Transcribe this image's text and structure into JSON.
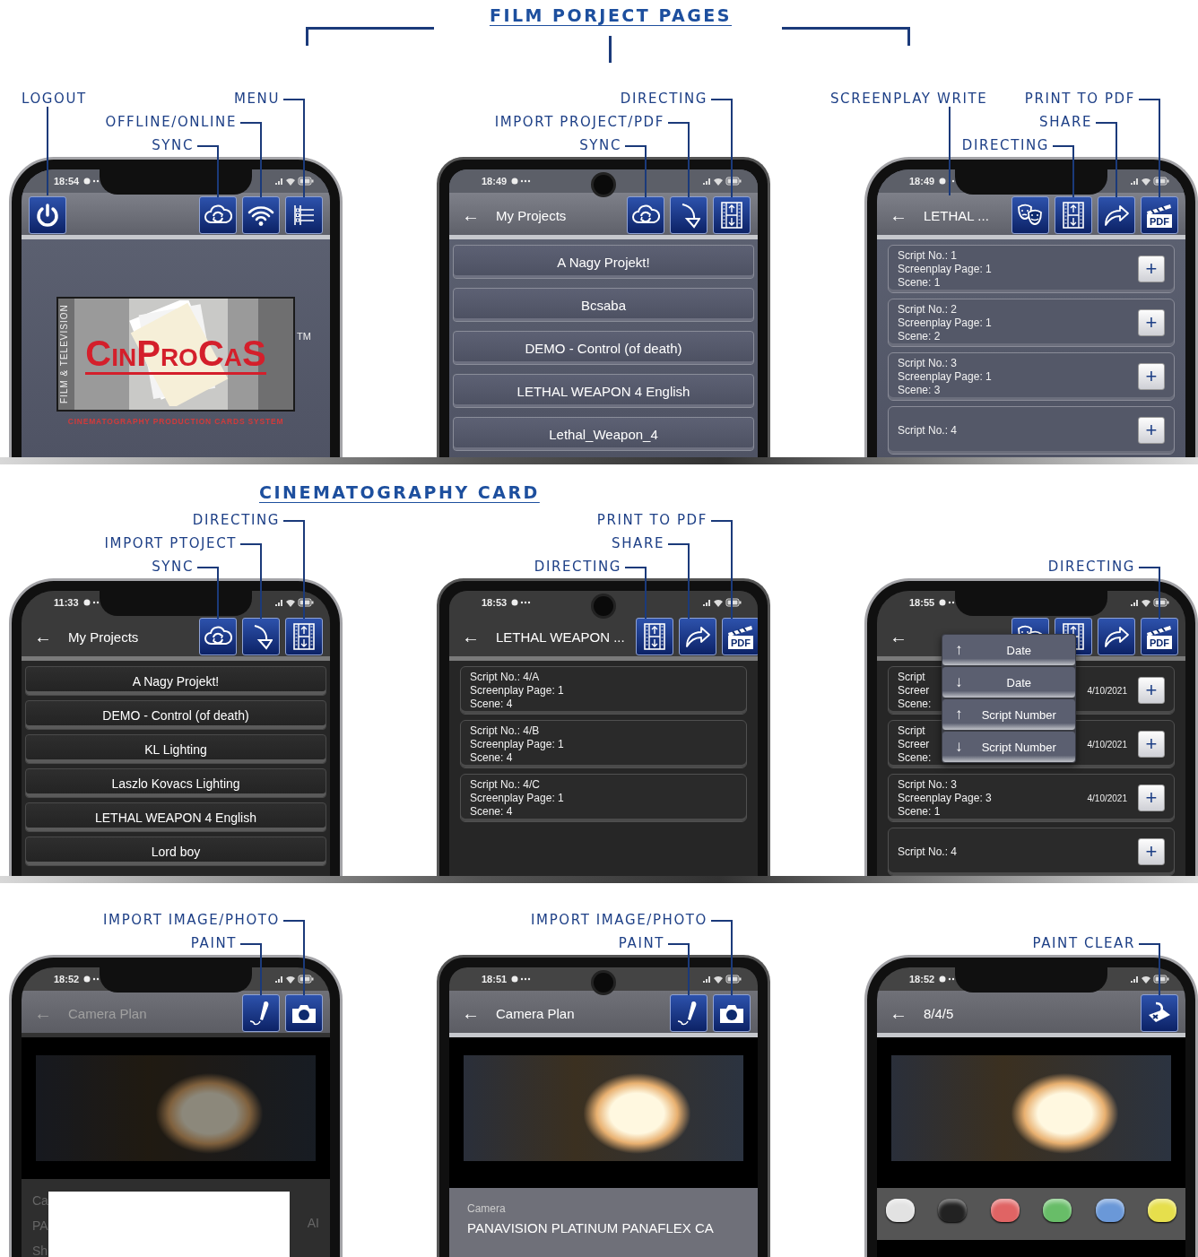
{
  "sections": [
    {
      "kind": "brackets",
      "title": "FILM PORJECT PAGES",
      "phones": [
        {
          "kind": "notch",
          "time": "18:54",
          "callouts": [
            {
              "label": "LOGOUT",
              "kind": "left"
            },
            {
              "label": "MENU",
              "kind": "right"
            },
            {
              "label": "OFFLINE/ONLINE",
              "kind": "right"
            },
            {
              "label": "SYNC",
              "kind": "right"
            }
          ],
          "appbar": {
            "left_icons": [
              {
                "kind": "power"
              }
            ],
            "icons": [
              {
                "kind": "sync"
              },
              {
                "kind": "wifi"
              },
              {
                "kind": "menu"
              }
            ]
          },
          "body": {
            "kind": "logo",
            "side_text": "FILM & TELEVISION",
            "name": "CinProCaS",
            "mark": "TM",
            "tagline": "CINEMATOGRAPHY PRODUCTION CARDS SYSTEM"
          }
        },
        {
          "kind": "punch",
          "time": "18:49",
          "callouts": [
            {
              "label": "DIRECTING",
              "kind": "right"
            },
            {
              "label": "IMPORT PROJECT/PDF",
              "kind": "right"
            },
            {
              "label": "SYNC",
              "kind": "right"
            }
          ],
          "appbar": {
            "back": "←",
            "title": "My Projects",
            "icons": [
              {
                "kind": "sync"
              },
              {
                "kind": "import"
              },
              {
                "kind": "film"
              }
            ]
          },
          "body": {
            "kind": "projects",
            "items": [
              "A Nagy Projekt!",
              "Bcsaba",
              "DEMO - Control (of death)",
              "LETHAL WEAPON 4 English",
              "Lethal_Weapon_4"
            ]
          }
        },
        {
          "kind": "notch",
          "time": "18:49",
          "callouts": [
            {
              "label": "SCREENPLAY WRITE",
              "kind": "left"
            },
            {
              "label": "PRINT TO PDF",
              "kind": "right"
            },
            {
              "label": "SHARE",
              "kind": "right"
            },
            {
              "label": "DIRECTING",
              "kind": "right"
            }
          ],
          "appbar": {
            "back": "←",
            "title": "LETHAL ...",
            "icons": [
              {
                "kind": "masks"
              },
              {
                "kind": "film"
              },
              {
                "kind": "share"
              },
              {
                "kind": "pdf",
                "text": "PDF"
              }
            ]
          },
          "body": {
            "kind": "cards",
            "cards": [
              {
                "lines": [
                  "Script No.: 1",
                  "Screenplay Page: 1",
                  "Scene: 1"
                ],
                "action": "+"
              },
              {
                "lines": [
                  "Script No.: 2",
                  "Screenplay Page: 1",
                  "Scene: 2"
                ],
                "action": "+"
              },
              {
                "lines": [
                  "Script No.: 3",
                  "Screenplay Page: 1",
                  "Scene: 3"
                ],
                "action": "+"
              },
              {
                "lines": [
                  "Script No.: 4"
                ],
                "action": "+"
              }
            ]
          }
        }
      ]
    },
    {
      "kind": "underline",
      "title": "CINEMATOGRAPHY CARD",
      "phones": [
        {
          "kind": "notch",
          "time": "11:33",
          "callouts": [
            {
              "label": "DIRECTING",
              "kind": "right"
            },
            {
              "label": "IMPORT PTOJECT",
              "kind": "right"
            },
            {
              "label": "SYNC",
              "kind": "right"
            }
          ],
          "appbar": {
            "back": "←",
            "title": "My Projects",
            "icons": [
              {
                "kind": "sync"
              },
              {
                "kind": "import"
              },
              {
                "kind": "film"
              }
            ]
          },
          "body": {
            "kind": "projects",
            "items": [
              "A Nagy Projekt!",
              "DEMO - Control (of death)",
              "KL Lighting",
              "Laszlo Kovacs Lighting",
              "LETHAL WEAPON 4 English",
              "Lord boy"
            ]
          }
        },
        {
          "kind": "punch",
          "time": "18:53",
          "callouts": [
            {
              "label": "PRINT TO PDF",
              "kind": "right"
            },
            {
              "label": "SHARE",
              "kind": "right"
            },
            {
              "label": "DIRECTING",
              "kind": "right"
            }
          ],
          "appbar": {
            "back": "←",
            "title": "LETHAL WEAPON ...",
            "icons": [
              {
                "kind": "film"
              },
              {
                "kind": "share"
              },
              {
                "kind": "pdf",
                "text": "PDF"
              }
            ]
          },
          "body": {
            "kind": "cards",
            "cards": [
              {
                "lines": [
                  "Script No.: 4/A",
                  "Screenplay Page: 1",
                  "Scene: 4"
                ]
              },
              {
                "lines": [
                  "Script No.: 4/B",
                  "Screenplay Page: 1",
                  "Scene: 4"
                ]
              },
              {
                "lines": [
                  "Script No.: 4/C",
                  "Screenplay Page: 1",
                  "Scene: 4"
                ]
              }
            ]
          }
        },
        {
          "kind": "notch",
          "time": "18:55",
          "callouts": [
            {
              "label": "DIRECTING",
              "kind": "right"
            }
          ],
          "appbar": {
            "back": "←",
            "icons": [
              {
                "kind": "masks"
              },
              {
                "kind": "film"
              },
              {
                "kind": "share"
              },
              {
                "kind": "pdf",
                "text": "PDF"
              }
            ]
          },
          "body": {
            "kind": "cards",
            "cards": [
              {
                "lines": [
                  "Script",
                  "Screer",
                  "Scene:"
                ],
                "date": "4/10/2021",
                "action": "+"
              },
              {
                "lines": [
                  "Script",
                  "Screer",
                  "Scene:"
                ],
                "date": "4/10/2021",
                "action": "+"
              },
              {
                "lines": [
                  "Script No.: 3",
                  "Screenplay Page: 3",
                  "Scene: 1"
                ],
                "date": "4/10/2021",
                "action": "+"
              },
              {
                "lines": [
                  "Script No.: 4"
                ],
                "action": "+"
              }
            ],
            "menu": [
              {
                "arrow": "↑",
                "label": "Date"
              },
              {
                "arrow": "↓",
                "label": "Date"
              },
              {
                "arrow": "↑",
                "label": "Script Number"
              },
              {
                "arrow": "↓",
                "label": "Script Number"
              }
            ]
          }
        }
      ]
    },
    {
      "kind": "none",
      "phones": [
        {
          "kind": "notch",
          "dimmed": true,
          "time": "18:52",
          "callouts": [
            {
              "label": "IMPORT IMAGE/PHOTO",
              "kind": "right"
            },
            {
              "label": "PAINT",
              "kind": "right"
            }
          ],
          "appbar": {
            "back": "←",
            "title": "Camera Plan",
            "icons": [
              {
                "kind": "paint"
              },
              {
                "kind": "camera"
              }
            ]
          },
          "body": {
            "kind": "photo",
            "behind": {
              "left": [
                "Ca",
                "PA",
                "Sh"
              ],
              "right": [
                "AI"
              ]
            },
            "dialog": true
          }
        },
        {
          "kind": "punch",
          "time": "18:51",
          "callouts": [
            {
              "label": "IMPORT IMAGE/PHOTO",
              "kind": "right"
            },
            {
              "label": "PAINT",
              "kind": "right"
            }
          ],
          "appbar": {
            "back": "←",
            "title": "Camera Plan",
            "icons": [
              {
                "kind": "paint"
              },
              {
                "kind": "camera"
              }
            ]
          },
          "body": {
            "kind": "photo",
            "field": {
              "label": "Camera",
              "value": "PANAVISION PLATINUM PANAFLEX CA"
            }
          }
        },
        {
          "kind": "notch",
          "time": "18:52",
          "callouts": [
            {
              "label": "PAINT CLEAR",
              "kind": "right"
            }
          ],
          "appbar": {
            "back": "←",
            "title": "8/4/5",
            "icons": [
              {
                "kind": "clear"
              }
            ]
          },
          "body": {
            "kind": "photo",
            "swatches": [
              {
                "color": "#e2e2e2"
              },
              {
                "color": "#222222"
              },
              {
                "color": "#e06464"
              },
              {
                "color": "#68bd68"
              },
              {
                "color": "#6a98d8"
              },
              {
                "color": "#e6df4c"
              }
            ]
          }
        }
      ]
    }
  ]
}
